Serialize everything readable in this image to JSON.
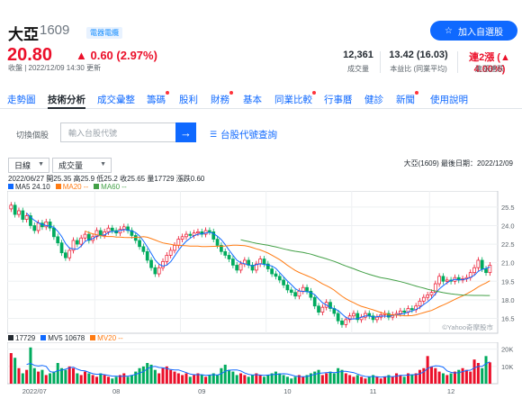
{
  "stock": {
    "name": "大亞",
    "code": "1609",
    "badge": "電器電纜",
    "price": "20.80",
    "change": "▲ 0.60 (2.97%)",
    "timestamp": "收盤 | 2022/12/09 14:30 更新",
    "add_watchlist": "加入自選股"
  },
  "stats": [
    {
      "value": "12,361",
      "label": "成交量"
    },
    {
      "value": "13.42 (16.03)",
      "label": "本益比 (同業平均)"
    },
    {
      "value": "連2漲 (▲ 4.00%)",
      "label": "連漲連跌"
    }
  ],
  "nav": [
    {
      "label": "走勢圖",
      "dot": false
    },
    {
      "label": "技術分析",
      "dot": false,
      "active": true
    },
    {
      "label": "成交彙整",
      "dot": false
    },
    {
      "label": "籌碼",
      "dot": true
    },
    {
      "label": "股利",
      "dot": false
    },
    {
      "label": "財務",
      "dot": true
    },
    {
      "label": "基本",
      "dot": false
    },
    {
      "label": "同業比較",
      "dot": true
    },
    {
      "label": "行事曆",
      "dot": false
    },
    {
      "label": "健診",
      "dot": false
    },
    {
      "label": "新聞",
      "dot": true
    },
    {
      "label": "使用說明",
      "dot": false
    }
  ],
  "switcher": {
    "label": "切換個股",
    "placeholder": "輸入台股代號",
    "lookup": "台股代號查詢"
  },
  "controls": {
    "period": "日線",
    "indicator": "成交量"
  },
  "chart_meta": {
    "header": "大亞(1609)   最後日期：2022/12/09",
    "ohlc": "2022/06/27 開25.35 高25.9 低25.2 收25.65 量17729 漲跌0.60",
    "ma5": "MA5 24.10",
    "ma20": "MA20 --",
    "ma60": "MA60 --",
    "vol": "17729",
    "vma5": "MV5 10678",
    "vma20": "MV20 --",
    "watermark": "©Yahoo奇摩股市",
    "colors": {
      "ma5": "#0f69ff",
      "ma20": "#ff7b12",
      "ma60": "#43a047",
      "up": "#eb0f29",
      "down": "#00ab5e"
    }
  },
  "chart_data": {
    "type": "candlestick",
    "y_ticks": [
      16.5,
      18.0,
      19.5,
      21.0,
      22.5,
      24.0,
      25.5
    ],
    "ylim": [
      15.3,
      26.8
    ],
    "x_labels": [
      "2022/07",
      "08",
      "09",
      "10",
      "11",
      "12"
    ],
    "vol_ticks": [
      "20K",
      "10K"
    ],
    "vol_max": 24000,
    "closes": [
      25.65,
      24.9,
      25.2,
      24.5,
      24.8,
      24.0,
      23.6,
      24.2,
      23.9,
      24.3,
      23.8,
      23.1,
      22.6,
      21.8,
      21.4,
      22.0,
      22.8,
      22.5,
      23.0,
      23.3,
      22.8,
      23.1,
      23.6,
      23.2,
      23.5,
      23.8,
      23.6,
      23.4,
      23.7,
      23.9,
      23.6,
      23.2,
      22.8,
      22.3,
      21.9,
      21.2,
      20.6,
      20.1,
      20.6,
      21.1,
      21.6,
      22.0,
      22.4,
      22.9,
      23.1,
      23.3,
      23.2,
      23.4,
      23.5,
      23.3,
      23.6,
      23.5,
      22.9,
      22.4,
      21.9,
      21.6,
      21.3,
      20.8,
      20.4,
      20.9,
      21.2,
      20.8,
      20.4,
      20.9,
      21.3,
      20.9,
      20.5,
      20.1,
      19.9,
      19.6,
      19.2,
      18.8,
      18.6,
      18.3,
      18.7,
      19.0,
      18.7,
      18.2,
      17.5,
      17.0,
      17.4,
      17.8,
      17.3,
      16.9,
      16.3,
      16.0,
      16.4,
      16.7,
      16.9,
      16.4,
      16.6,
      16.9,
      16.7,
      16.4,
      16.6,
      16.8,
      16.9,
      16.6,
      16.8,
      16.9,
      17.1,
      17.0,
      17.3,
      17.2,
      17.5,
      17.9,
      18.2,
      18.4,
      18.6,
      19.3,
      19.9,
      19.5,
      19.6,
      19.5,
      19.8,
      19.6,
      19.7,
      19.8,
      20.2,
      20.6,
      21.2,
      20.5,
      20.2,
      20.8
    ],
    "volumes": [
      17729,
      15000,
      9000,
      6000,
      8000,
      21000,
      9000,
      7000,
      8000,
      5000,
      6000,
      7000,
      12000,
      9000,
      8000,
      10000,
      9000,
      6000,
      5000,
      7000,
      6000,
      5000,
      4000,
      6000,
      5000,
      4000,
      3000,
      4000,
      5000,
      6000,
      4000,
      5000,
      7000,
      9000,
      10000,
      12000,
      11000,
      8000,
      6000,
      9000,
      10000,
      8000,
      7000,
      6000,
      5000,
      6000,
      4000,
      5000,
      6000,
      5000,
      4000,
      5000,
      6000,
      5000,
      9000,
      11000,
      8000,
      7000,
      5000,
      6000,
      5000,
      4000,
      5000,
      6000,
      5000,
      4000,
      5000,
      6000,
      7000,
      6000,
      5000,
      4000,
      3000,
      4000,
      5000,
      4000,
      5000,
      6000,
      7000,
      8000,
      5000,
      6000,
      7000,
      6000,
      9000,
      8000,
      6000,
      5000,
      4000,
      5000,
      4000,
      3000,
      4000,
      5000,
      4000,
      3000,
      4000,
      5000,
      4000,
      6000,
      5000,
      4000,
      6000,
      5000,
      6000,
      8000,
      9000,
      16000,
      10000,
      9000,
      7000,
      6000,
      5000,
      6000,
      7000,
      8000,
      9000,
      8000,
      7000,
      14000,
      12000,
      9000,
      16000,
      12361
    ]
  }
}
